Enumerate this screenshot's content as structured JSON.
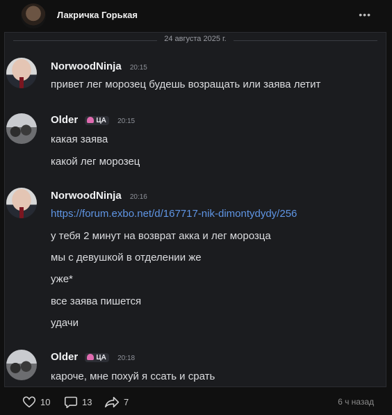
{
  "post": {
    "author": "Лакричка Горькая",
    "more_icon": "more-icon",
    "time_ago": "6 ч назад",
    "actions": {
      "likes": "10",
      "comments": "13",
      "reposts": "7"
    }
  },
  "chat": {
    "date": "24 августа 2025 г.",
    "messages": [
      {
        "author": "NorwoodNinja",
        "time": "20:15",
        "lines": [
          "привет лег морозец будешь возращать или заява летит"
        ]
      },
      {
        "author": "Older",
        "badge": "ЦА",
        "time": "20:15",
        "lines": [
          "какая заява",
          "какой лег морозец"
        ]
      },
      {
        "author": "NorwoodNinja",
        "time": "20:16",
        "link": "https://forum.exbo.net/d/167717-nik-dimontydydy/256",
        "lines": [
          "у тебя 2 минут на возврат акка и лег морозца",
          "мы с девушкой в отделении же",
          "уже*",
          "все заява пишется",
          "удачи"
        ]
      },
      {
        "author": "Older",
        "badge": "ЦА",
        "time": "20:18",
        "lines": [
          "кароче, мне похуй я ссать и срать"
        ]
      }
    ]
  }
}
